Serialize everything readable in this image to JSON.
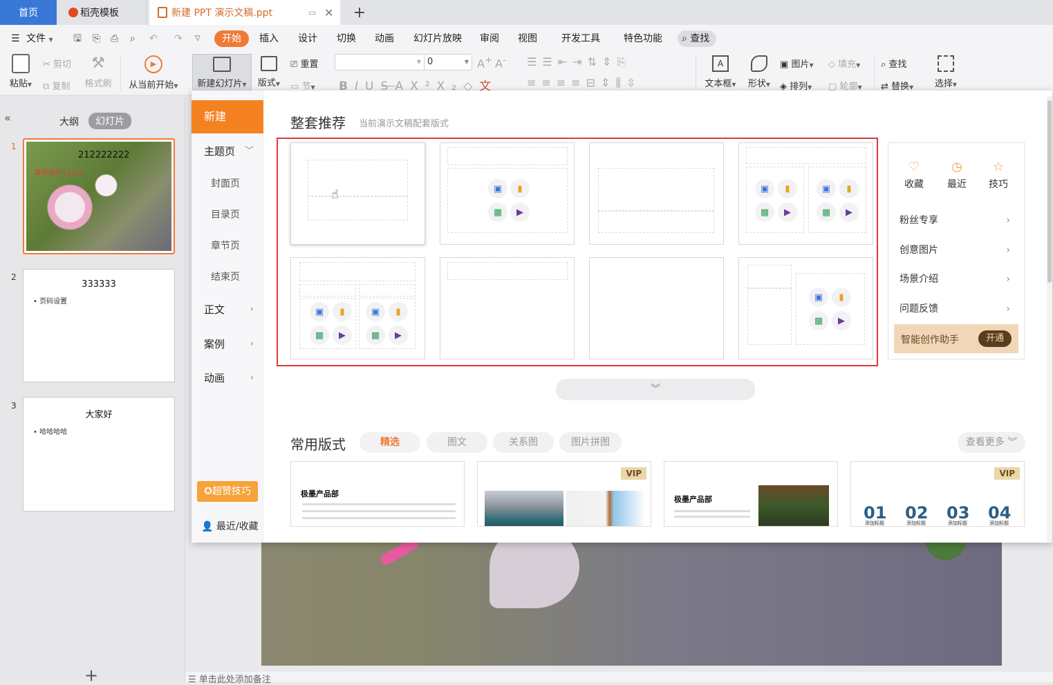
{
  "tabs": {
    "home": "首页",
    "docer": "稻壳模板",
    "doc": "新建 PPT 演示文稿.ppt",
    "plus": "+"
  },
  "menu": {
    "file": "文件",
    "start": "开始",
    "insert": "插入",
    "design": "设计",
    "switch": "切换",
    "animation": "动画",
    "slideshow": "幻灯片放映",
    "review": "审阅",
    "view": "视图",
    "devtools": "开发工具",
    "special": "特色功能",
    "search": "查找"
  },
  "ribbon": {
    "paste": "粘贴",
    "cut": "剪切",
    "copy": "复制",
    "format_brush": "格式刷",
    "from_current": "从当前开始",
    "new_slide": "新建幻灯片",
    "layout": "版式",
    "reset": "重置",
    "section": "节",
    "font_size": "0",
    "textbox": "文本框",
    "shape": "形状",
    "picture": "图片",
    "fill": "填充",
    "arrange": "排列",
    "outline": "轮廓",
    "find": "查找",
    "replace": "替换",
    "select": "选择"
  },
  "leftpanel": {
    "outline_tab": "大纲",
    "slides_tab": "幻灯片",
    "add": "+",
    "slides": [
      {
        "num": "1",
        "title": "212222222",
        "subtitle": "首系组片11111"
      },
      {
        "num": "2",
        "title": "333333",
        "bullet": "页码设置"
      },
      {
        "num": "3",
        "title": "大家好",
        "bullet": "哈哈哈哈"
      }
    ]
  },
  "notes": "单击此处添加备注",
  "popup": {
    "nav": {
      "new": "新建",
      "theme": "主题页",
      "cover": "封面页",
      "toc": "目录页",
      "chapter": "章节页",
      "end": "结束页",
      "body": "正文",
      "case": "案例",
      "anim": "动画",
      "tips_btn": "超赞技巧",
      "recent": "最近/收藏"
    },
    "section_title": "整套推荐",
    "section_sub": "当前演示文稿配套版式",
    "side": {
      "fav": "收藏",
      "recent": "最近",
      "tips": "技巧",
      "links": [
        "粉丝专享",
        "创意图片",
        "场景介绍",
        "问题反馈"
      ],
      "assistant": "智能创作助手",
      "open": "开通"
    },
    "common_title": "常用版式",
    "filters": [
      "精选",
      "图文",
      "关系图",
      "图片拼图"
    ],
    "more": "查看更多",
    "cards": [
      {
        "title": "极墨产品部",
        "vip": ""
      },
      {
        "title": "",
        "vip": "VIP"
      },
      {
        "title": "极墨产品部",
        "vip": ""
      },
      {
        "title": "",
        "vip": "VIP",
        "nums": [
          "01",
          "02",
          "03",
          "04"
        ],
        "label": "添加标题"
      }
    ]
  },
  "colors": {
    "accent": "#f07a35",
    "tab_blue": "#3a78d8",
    "highlight_red": "#d93b3b"
  }
}
